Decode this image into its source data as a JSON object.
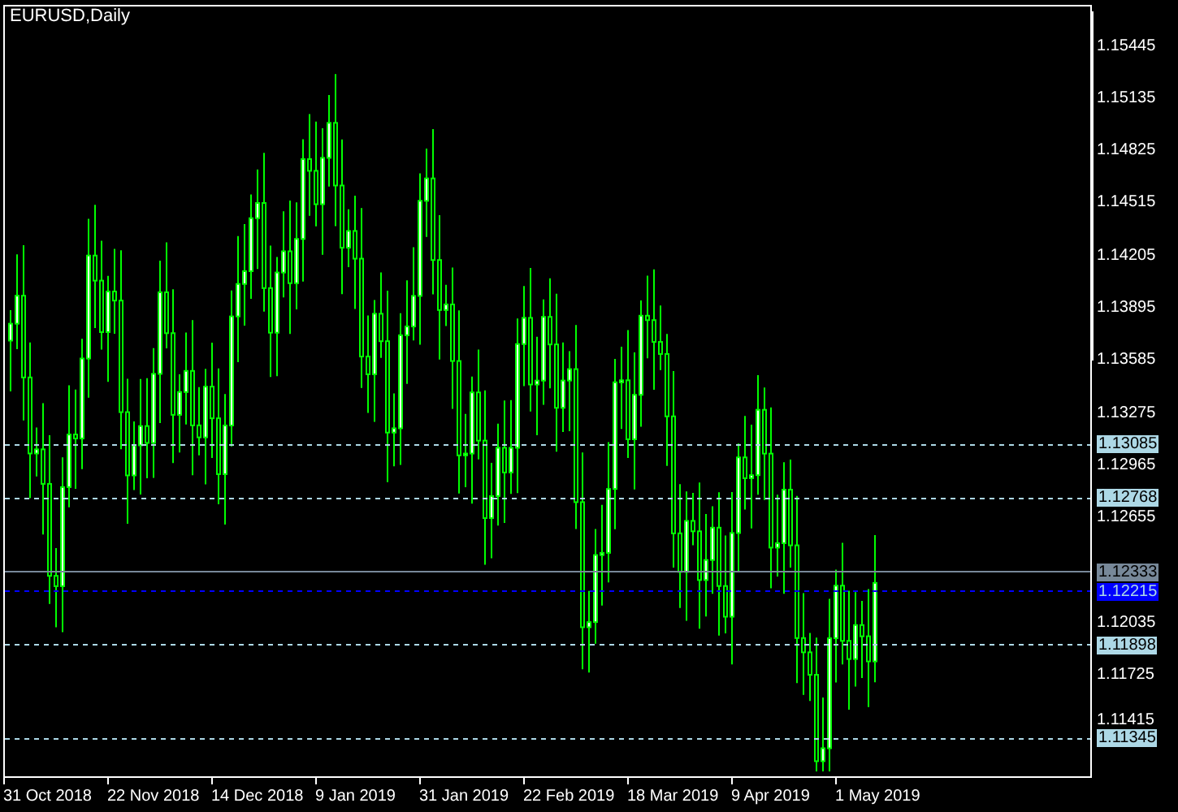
{
  "title": "EURUSD,Daily",
  "price_axis": {
    "labels": [
      "1.15445",
      "1.15135",
      "1.14825",
      "1.14515",
      "1.14205",
      "1.13895",
      "1.13585",
      "1.13275",
      "1.12965",
      "1.12655",
      "1.12035",
      "1.11725",
      "1.11415"
    ]
  },
  "price_tags": [
    {
      "text": "1.13085",
      "kind": "level"
    },
    {
      "text": "1.12768",
      "kind": "level"
    },
    {
      "text": "1.12333",
      "kind": "last"
    },
    {
      "text": "1.12215",
      "kind": "bid"
    },
    {
      "text": "1.11898",
      "kind": "level"
    },
    {
      "text": "1.11345",
      "kind": "level"
    }
  ],
  "time_axis": {
    "labels": [
      "31 Oct 2018",
      "22 Nov 2018",
      "14 Dec 2018",
      "9 Jan 2019",
      "31 Jan 2019",
      "22 Feb 2019",
      "18 Mar 2019",
      "9 Apr 2019",
      "1 May 2019"
    ]
  }
}
